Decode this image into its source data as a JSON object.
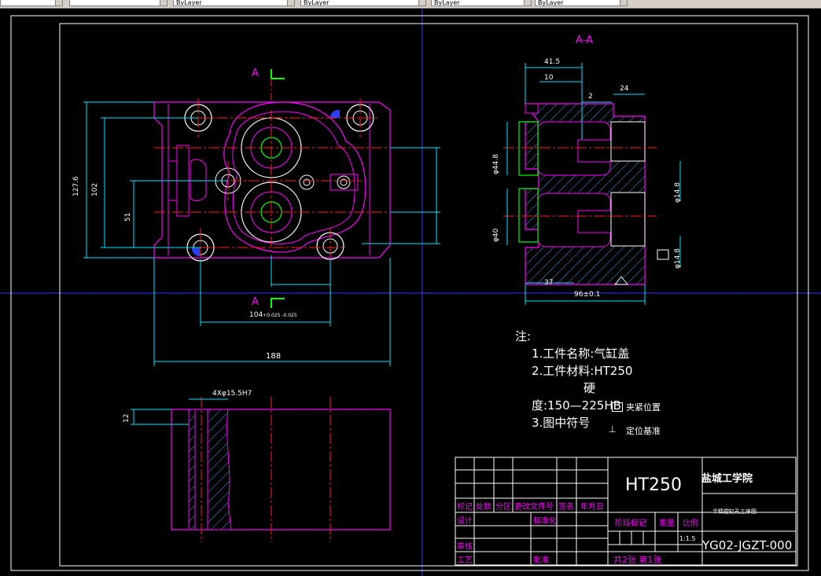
{
  "toolbar": {
    "combo1": "",
    "combo2": "",
    "combo3": "ByLayer",
    "combo4": "ByLayer",
    "combo5": "ByLayer",
    "combo6": "ByLayer"
  },
  "views": {
    "section_label": "A-A",
    "cut_label_top": "A",
    "cut_label_bottom": "A"
  },
  "dimensions": {
    "d188": "188",
    "d104": "104",
    "d104_tol": "+0.025 -0.025",
    "d127": "127.6",
    "d102": "102",
    "d51": "51",
    "d41_5": "41.5",
    "d10": "10",
    "d2": "2",
    "d24": "24",
    "d37": "37",
    "d96": "96±0.1",
    "d4x": "4Xφ15.5H7",
    "d12": "12",
    "d44": "φ44.8",
    "d40": "φ40",
    "d14a": "φ14.8",
    "d14b": "φ14.8"
  },
  "notes": {
    "heading": "注:",
    "line1": "1.工件名称:气缸盖",
    "line2": "2.工件材料:HT250",
    "line3a": "硬",
    "line3b": "度:150—225HB",
    "line4": "3.图中符号",
    "legend_clamp": "夹紧位置",
    "legend_locate": "定位基准"
  },
  "title_block": {
    "material": "HT250",
    "school": "盐城工学院",
    "drawing_name": "半精镗缸孔工序图",
    "drawing_no": "YG02-JGZT-000",
    "scale": "1:1.5",
    "sheets": "共2张 第1张",
    "h_mark": "标记",
    "h_count": "处数",
    "h_zone": "分区",
    "h_docno": "更改文件号",
    "h_sign": "签名",
    "h_date": "年月日",
    "r_design": "设计",
    "r_std": "标准化",
    "r_stage": "阶段标记",
    "r_weight": "重量",
    "r_scale": "比例",
    "r_check": "审核",
    "r_process": "工艺",
    "r_approve": "批准"
  }
}
